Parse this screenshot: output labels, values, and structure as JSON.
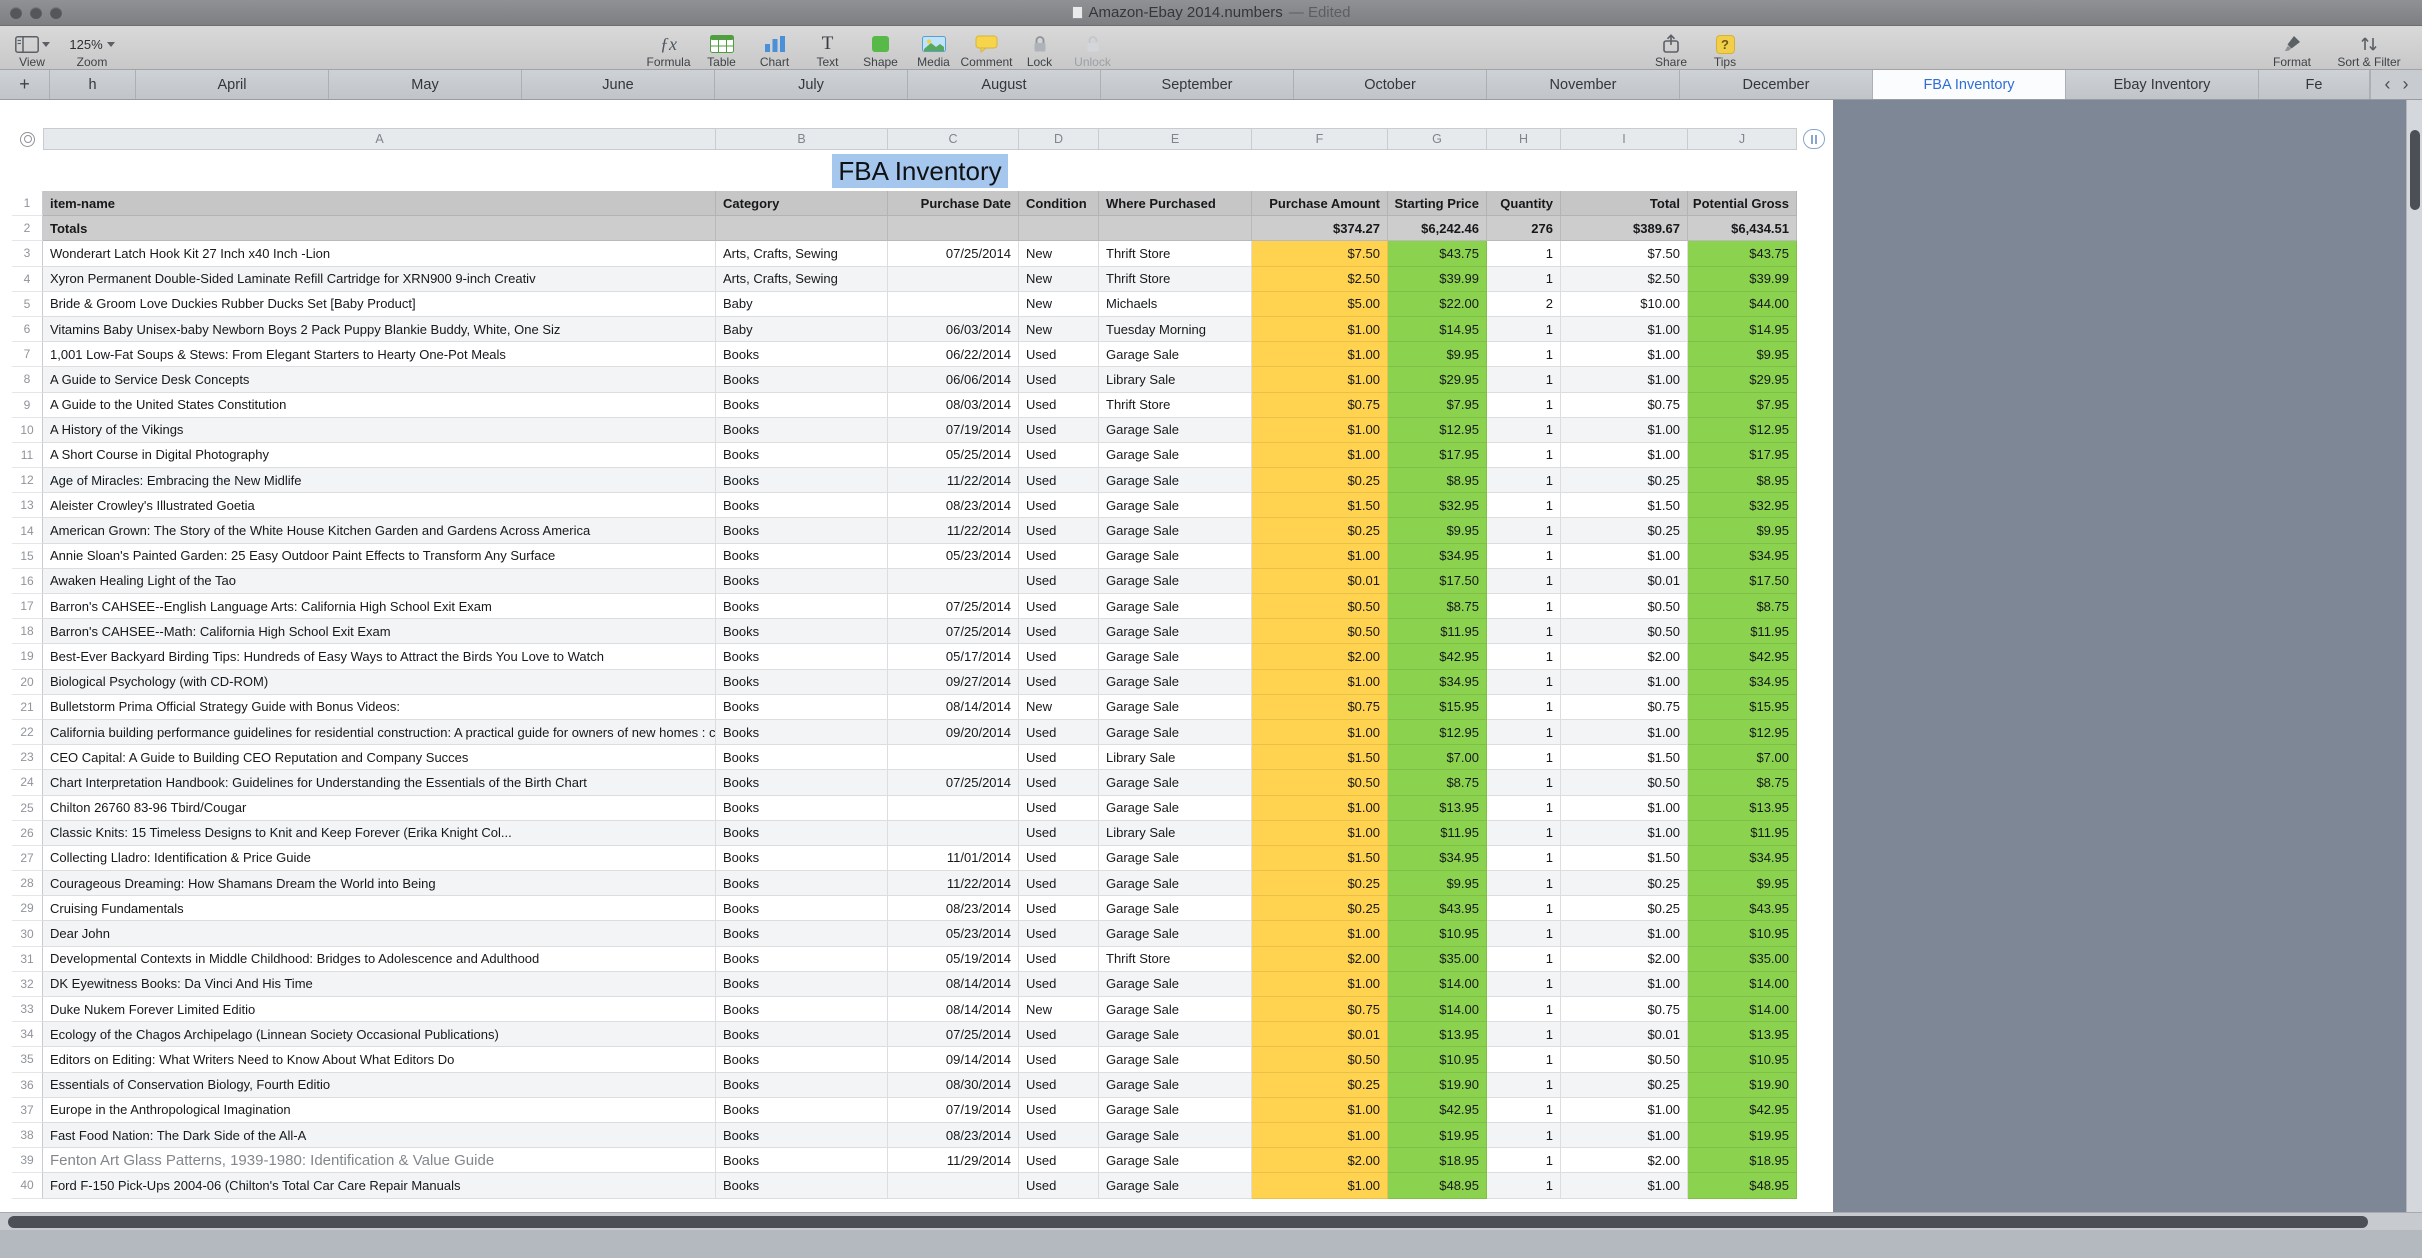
{
  "titlebar": {
    "title": "Amazon-Ebay 2014.numbers",
    "edited": "— Edited"
  },
  "toolbar": {
    "view": {
      "label": "View"
    },
    "zoom": {
      "label": "Zoom",
      "value": "125%"
    },
    "items": [
      {
        "label": "Formula",
        "glyph": "ƒx"
      },
      {
        "label": "Table"
      },
      {
        "label": "Chart"
      },
      {
        "label": "Text",
        "glyph": "T"
      },
      {
        "label": "Shape"
      },
      {
        "label": "Media"
      },
      {
        "label": "Comment"
      },
      {
        "label": "Lock"
      },
      {
        "label": "Unlock"
      }
    ],
    "share": {
      "label": "Share"
    },
    "tips": {
      "label": "Tips",
      "glyph": "?"
    },
    "format": {
      "label": "Format"
    },
    "sort_filter": {
      "label": "Sort & Filter"
    }
  },
  "tabbar": {
    "add_button": "+",
    "tabs": [
      "h",
      "April",
      "May",
      "June",
      "July",
      "August",
      "September",
      "October",
      "November",
      "December",
      "FBA Inventory",
      "Ebay Inventory",
      "Fe"
    ],
    "selected": "FBA Inventory",
    "nav_prev": "‹",
    "nav_next": "›"
  },
  "sheet": {
    "title": "FBA Inventory",
    "column_letters": [
      "A",
      "B",
      "C",
      "D",
      "E",
      "F",
      "G",
      "H",
      "I",
      "J"
    ],
    "header": [
      "item-name",
      "Category",
      "Purchase Date",
      "Condition",
      "Where Purchased",
      "Purchase Amount",
      "Starting Price",
      "Quantity",
      "Total",
      "Potential Gross"
    ],
    "totals": [
      "Totals",
      "",
      "",
      "",
      "",
      "$374.27",
      "$6,242.46",
      "276",
      "$389.67",
      "$6,434.51"
    ],
    "muted_row": 39,
    "rows": [
      [
        "Wonderart Latch Hook Kit 27 Inch x40 Inch -Lion",
        "Arts, Crafts, Sewing",
        "07/25/2014",
        "New",
        "Thrift Store",
        "$7.50",
        "$43.75",
        "1",
        "$7.50",
        "$43.75"
      ],
      [
        "Xyron Permanent Double-Sided Laminate Refill Cartridge for XRN900 9-inch Creativ",
        "Arts, Crafts, Sewing",
        "",
        "New",
        "Thrift Store",
        "$2.50",
        "$39.99",
        "1",
        "$2.50",
        "$39.99"
      ],
      [
        "Bride & Groom Love Duckies Rubber Ducks Set [Baby Product]",
        "Baby",
        "",
        "New",
        "Michaels",
        "$5.00",
        "$22.00",
        "2",
        "$10.00",
        "$44.00"
      ],
      [
        "Vitamins Baby Unisex-baby Newborn Boys 2 Pack Puppy Blankie Buddy, White, One Siz",
        "Baby",
        "06/03/2014",
        "New",
        "Tuesday Morning",
        "$1.00",
        "$14.95",
        "1",
        "$1.00",
        "$14.95"
      ],
      [
        "1,001 Low-Fat Soups & Stews: From Elegant Starters to Hearty One-Pot Meals",
        "Books",
        "06/22/2014",
        "Used",
        "Garage Sale",
        "$1.00",
        "$9.95",
        "1",
        "$1.00",
        "$9.95"
      ],
      [
        "A Guide to Service Desk Concepts",
        "Books",
        "06/06/2014",
        "Used",
        "Library Sale",
        "$1.00",
        "$29.95",
        "1",
        "$1.00",
        "$29.95"
      ],
      [
        "A Guide to the United States Constitution",
        "Books",
        "08/03/2014",
        "Used",
        "Thrift Store",
        "$0.75",
        "$7.95",
        "1",
        "$0.75",
        "$7.95"
      ],
      [
        "A History of the Vikings",
        "Books",
        "07/19/2014",
        "Used",
        "Garage Sale",
        "$1.00",
        "$12.95",
        "1",
        "$1.00",
        "$12.95"
      ],
      [
        "A Short Course in Digital Photography",
        "Books",
        "05/25/2014",
        "Used",
        "Garage Sale",
        "$1.00",
        "$17.95",
        "1",
        "$1.00",
        "$17.95"
      ],
      [
        "Age of Miracles: Embracing the New Midlife",
        "Books",
        "11/22/2014",
        "Used",
        "Garage Sale",
        "$0.25",
        "$8.95",
        "1",
        "$0.25",
        "$8.95"
      ],
      [
        "Aleister Crowley's Illustrated Goetia",
        "Books",
        "08/23/2014",
        "Used",
        "Garage Sale",
        "$1.50",
        "$32.95",
        "1",
        "$1.50",
        "$32.95"
      ],
      [
        "American Grown: The Story of the White House Kitchen Garden and Gardens Across America",
        "Books",
        "11/22/2014",
        "Used",
        "Garage Sale",
        "$0.25",
        "$9.95",
        "1",
        "$0.25",
        "$9.95"
      ],
      [
        "Annie Sloan's Painted Garden: 25 Easy Outdoor Paint Effects to Transform Any Surface",
        "Books",
        "05/23/2014",
        "Used",
        "Garage Sale",
        "$1.00",
        "$34.95",
        "1",
        "$1.00",
        "$34.95"
      ],
      [
        "Awaken Healing Light of the Tao",
        "Books",
        "",
        "Used",
        "Garage Sale",
        "$0.01",
        "$17.50",
        "1",
        "$0.01",
        "$17.50"
      ],
      [
        "Barron's CAHSEE--English Language Arts: California High School Exit Exam",
        "Books",
        "07/25/2014",
        "Used",
        "Garage Sale",
        "$0.50",
        "$8.75",
        "1",
        "$0.50",
        "$8.75"
      ],
      [
        "Barron's CAHSEE--Math: California High School Exit Exam",
        "Books",
        "07/25/2014",
        "Used",
        "Garage Sale",
        "$0.50",
        "$11.95",
        "1",
        "$0.50",
        "$11.95"
      ],
      [
        "Best-Ever Backyard Birding Tips: Hundreds of Easy Ways to Attract the Birds You Love to Watch",
        "Books",
        "05/17/2014",
        "Used",
        "Garage Sale",
        "$2.00",
        "$42.95",
        "1",
        "$2.00",
        "$42.95"
      ],
      [
        "Biological Psychology (with CD-ROM)",
        "Books",
        "09/27/2014",
        "Used",
        "Garage Sale",
        "$1.00",
        "$34.95",
        "1",
        "$1.00",
        "$34.95"
      ],
      [
        "Bulletstorm Prima Official Strategy Guide with Bonus Videos:",
        "Books",
        "08/14/2014",
        "New",
        "Garage Sale",
        "$0.75",
        "$15.95",
        "1",
        "$0.75",
        "$15.95"
      ],
      [
        "California building performance guidelines for residential construction: A practical guide for owners of new homes : constr",
        "Books",
        "09/20/2014",
        "Used",
        "Garage Sale",
        "$1.00",
        "$12.95",
        "1",
        "$1.00",
        "$12.95"
      ],
      [
        "CEO Capital: A Guide to Building CEO Reputation and Company Succes",
        "Books",
        "",
        "Used",
        "Library Sale",
        "$1.50",
        "$7.00",
        "1",
        "$1.50",
        "$7.00"
      ],
      [
        "Chart Interpretation Handbook: Guidelines for Understanding the Essentials of the Birth Chart",
        "Books",
        "07/25/2014",
        "Used",
        "Garage Sale",
        "$0.50",
        "$8.75",
        "1",
        "$0.50",
        "$8.75"
      ],
      [
        "Chilton 26760 83-96 Tbird/Cougar",
        "Books",
        "",
        "Used",
        "Garage Sale",
        "$1.00",
        "$13.95",
        "1",
        "$1.00",
        "$13.95"
      ],
      [
        "Classic Knits: 15 Timeless Designs to Knit and Keep Forever (Erika Knight Col...",
        "Books",
        "",
        "Used",
        "Library Sale",
        "$1.00",
        "$11.95",
        "1",
        "$1.00",
        "$11.95"
      ],
      [
        "Collecting Lladro: Identification & Price Guide",
        "Books",
        "11/01/2014",
        "Used",
        "Garage Sale",
        "$1.50",
        "$34.95",
        "1",
        "$1.50",
        "$34.95"
      ],
      [
        "Courageous Dreaming: How Shamans Dream the World into Being",
        "Books",
        "11/22/2014",
        "Used",
        "Garage Sale",
        "$0.25",
        "$9.95",
        "1",
        "$0.25",
        "$9.95"
      ],
      [
        "Cruising Fundamentals",
        "Books",
        "08/23/2014",
        "Used",
        "Garage Sale",
        "$0.25",
        "$43.95",
        "1",
        "$0.25",
        "$43.95"
      ],
      [
        "Dear John",
        "Books",
        "05/23/2014",
        "Used",
        "Garage Sale",
        "$1.00",
        "$10.95",
        "1",
        "$1.00",
        "$10.95"
      ],
      [
        "Developmental Contexts in Middle Childhood: Bridges to Adolescence and Adulthood",
        "Books",
        "05/19/2014",
        "Used",
        "Thrift Store",
        "$2.00",
        "$35.00",
        "1",
        "$2.00",
        "$35.00"
      ],
      [
        "DK Eyewitness Books: Da Vinci And His Time",
        "Books",
        "08/14/2014",
        "Used",
        "Garage Sale",
        "$1.00",
        "$14.00",
        "1",
        "$1.00",
        "$14.00"
      ],
      [
        "Duke Nukem Forever Limited Editio",
        "Books",
        "08/14/2014",
        "New",
        "Garage Sale",
        "$0.75",
        "$14.00",
        "1",
        "$0.75",
        "$14.00"
      ],
      [
        "Ecology of the Chagos Archipelago (Linnean Society Occasional Publications)",
        "Books",
        "07/25/2014",
        "Used",
        "Garage Sale",
        "$0.01",
        "$13.95",
        "1",
        "$0.01",
        "$13.95"
      ],
      [
        "Editors on Editing: What Writers Need to Know About What Editors Do",
        "Books",
        "09/14/2014",
        "Used",
        "Garage Sale",
        "$0.50",
        "$10.95",
        "1",
        "$0.50",
        "$10.95"
      ],
      [
        "Essentials of Conservation Biology, Fourth Editio",
        "Books",
        "08/30/2014",
        "Used",
        "Garage Sale",
        "$0.25",
        "$19.90",
        "1",
        "$0.25",
        "$19.90"
      ],
      [
        "Europe in the Anthropological Imagination",
        "Books",
        "07/19/2014",
        "Used",
        "Garage Sale",
        "$1.00",
        "$42.95",
        "1",
        "$1.00",
        "$42.95"
      ],
      [
        "Fast Food Nation: The Dark Side of the All-A",
        "Books",
        "08/23/2014",
        "Used",
        "Garage Sale",
        "$1.00",
        "$19.95",
        "1",
        "$1.00",
        "$19.95"
      ],
      [
        "Fenton Art Glass Patterns, 1939-1980: Identification & Value Guide",
        "Books",
        "11/29/2014",
        "Used",
        "Garage Sale",
        "$2.00",
        "$18.95",
        "1",
        "$2.00",
        "$18.95"
      ],
      [
        "Ford F-150 Pick-Ups 2004-06 (Chilton's Total Car Care Repair Manuals",
        "Books",
        "",
        "Used",
        "Garage Sale",
        "$1.00",
        "$48.95",
        "1",
        "$1.00",
        "$48.95"
      ]
    ]
  }
}
